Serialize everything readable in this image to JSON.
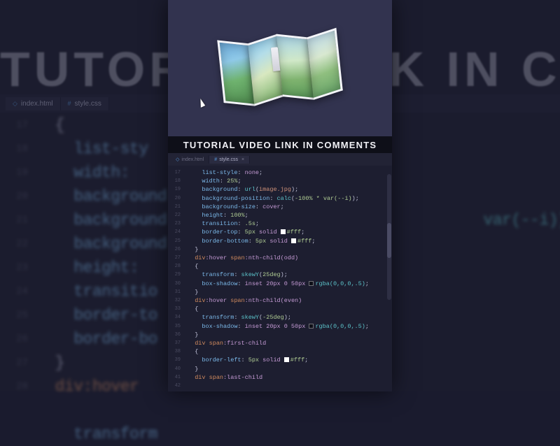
{
  "banner_text": "TUTORIAL LINK IN COMMENTS",
  "caption": "TUTORIAL VIDEO LINK IN COMMENTS",
  "bg_editor": {
    "tab1": "index.html",
    "tab2": "style.css",
    "gutter": [
      "17",
      "18",
      "19",
      "20",
      "21",
      "22",
      "23",
      "24",
      "25",
      "26",
      "27",
      "28"
    ],
    "lines": [
      {
        "indent": 1,
        "type": "val",
        "text": "{"
      },
      {
        "indent": 2,
        "type": "prop",
        "text": "list-sty"
      },
      {
        "indent": 2,
        "type": "prop",
        "text": "width:"
      },
      {
        "indent": 2,
        "type": "prop",
        "text": "background"
      },
      {
        "indent": 2,
        "type": "prop",
        "text": "background",
        "tail": "var(--i));"
      },
      {
        "indent": 2,
        "type": "prop",
        "text": "background"
      },
      {
        "indent": 2,
        "type": "prop",
        "text": "height:"
      },
      {
        "indent": 2,
        "type": "prop",
        "text": "transitio"
      },
      {
        "indent": 2,
        "type": "prop",
        "text": "border-to"
      },
      {
        "indent": 2,
        "type": "prop",
        "text": "border-bo"
      },
      {
        "indent": 1,
        "type": "punc",
        "text": "}"
      },
      {
        "indent": 1,
        "type": "sel",
        "text": "div:hover"
      },
      {
        "indent": 1,
        "type": "punc",
        "text": ""
      },
      {
        "indent": 2,
        "type": "prop",
        "text": "transform"
      }
    ]
  },
  "fg_editor": {
    "tab1": "index.html",
    "tab2": "style.css",
    "gutter_start": 17,
    "gutter_count": 26,
    "code": {
      "l1": "list-style",
      "v1": "none",
      "l2": "width",
      "v2": "25%",
      "l3": "background",
      "v3f": "url",
      "v3a": "image.jpg",
      "l4": "background-position",
      "v4f": "calc",
      "v4a": "-100% * var(--i)",
      "l5": "background-size",
      "v5": "cover",
      "l6": "height",
      "v6": "100%",
      "l7": "transition",
      "v7": ".5s",
      "l8": "border-top",
      "v8a": "5px",
      "v8b": "solid",
      "v8c": "#fff",
      "l9": "border-bottom",
      "v9a": "5px",
      "v9b": "solid",
      "v9c": "#fff",
      "s1": "div",
      "s1p": ":hover",
      "s1c": "span",
      "s1q": ":nth-child(odd)",
      "l10": "transform",
      "v10f": "skewY",
      "v10a": "25deg",
      "l11": "box-shadow",
      "v11": "inset 20px 0 50px",
      "v11c": "rgba(0,0,0,.5)",
      "s2": "div",
      "s2p": ":hover",
      "s2c": "span",
      "s2q": ":nth-child(even)",
      "l12": "transform",
      "v12f": "skewY",
      "v12a": "-25deg",
      "l13": "box-shadow",
      "v13": "inset 20px 0 50px",
      "v13c": "rgba(0,0,0,.5)",
      "s3": "div",
      "s3c": "span",
      "s3q": ":first-child",
      "l14": "border-left",
      "v14a": "5px",
      "v14b": "solid",
      "v14c": "#fff",
      "s4": "div",
      "s4c": "span",
      "s4q": ":last-child"
    }
  }
}
